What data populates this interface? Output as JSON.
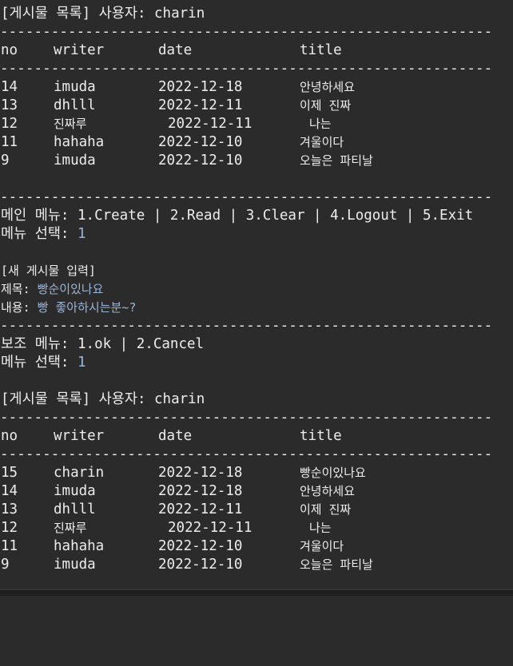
{
  "colors": {
    "background": "#2b2b2b",
    "text": "#ededed",
    "input_text": "#9ab5d6"
  },
  "separator": "----------------------------------------------------------------",
  "first_list": {
    "header": "[게시물 목록] 사용자: charin",
    "columns": [
      "no",
      "writer",
      "date",
      "title"
    ],
    "rows": [
      [
        "14",
        "imuda",
        "2022-12-18",
        "안녕하세요"
      ],
      [
        "13",
        "dhlll",
        "2022-12-11",
        "이제 진짜"
      ],
      [
        "12",
        "진짜루",
        "2022-12-11",
        "나는"
      ],
      [
        "11",
        "hahaha",
        "2022-12-10",
        "겨울이다"
      ],
      [
        "9",
        "imuda",
        "2022-12-10",
        "오늘은 파티날"
      ]
    ]
  },
  "main_menu": {
    "text": "메인 메뉴: 1.Create | 2.Read | 3.Clear | 4.Logout | 5.Exit",
    "prompt": "메뉴 선택: ",
    "selection": "1"
  },
  "new_post": {
    "header": "[새 게시물 입력]",
    "title_prompt": "제목: ",
    "title_value": "빵순이있나요",
    "content_prompt": "내용: ",
    "content_value": "빵 좋아하시는분~?"
  },
  "sub_menu": {
    "text": "보조 메뉴: 1.ok | 2.Cancel",
    "prompt": "메뉴 선택: ",
    "selection": "1"
  },
  "second_list": {
    "header": "[게시물 목록] 사용자: charin",
    "columns": [
      "no",
      "writer",
      "date",
      "title"
    ],
    "rows": [
      [
        "15",
        "charin",
        "2022-12-18",
        "빵순이있나요"
      ],
      [
        "14",
        "imuda",
        "2022-12-18",
        "안녕하세요"
      ],
      [
        "13",
        "dhlll",
        "2022-12-11",
        "이제 진짜"
      ],
      [
        "12",
        "진짜루",
        "2022-12-11",
        "나는"
      ],
      [
        "11",
        "hahaha",
        "2022-12-10",
        "겨울이다"
      ],
      [
        "9",
        "imuda",
        "2022-12-10",
        "오늘은 파티날"
      ]
    ]
  }
}
